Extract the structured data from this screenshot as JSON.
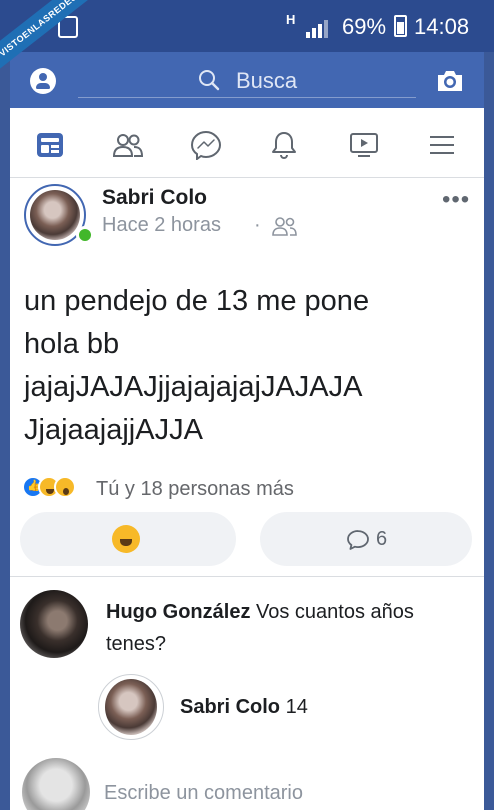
{
  "watermark": "VISTOENLASREDES",
  "status_bar": {
    "network": "H",
    "battery": "69%",
    "time": "14:08"
  },
  "search": {
    "placeholder": "Busca"
  },
  "nav_tabs": [
    "news-feed",
    "friends",
    "messenger",
    "notifications",
    "watch",
    "menu"
  ],
  "post": {
    "author": "Sabri Colo",
    "time": "Hace 2 horas",
    "separator": "·",
    "text_lines": [
      "un pendejo de 13 me pone",
      "hola bb",
      "jajajJAJAJjjajajajajJAJAJA",
      "JjajaajajjAJJA"
    ],
    "reaction_summary": "Tú y 18 personas más",
    "reaction_types": [
      "like",
      "haha",
      "wow"
    ],
    "comment_count": "6"
  },
  "comments": [
    {
      "author": "Hugo González",
      "text": "Vos cuantos años tenes?"
    }
  ],
  "reply": {
    "author": "Sabri Colo",
    "text": "14"
  },
  "composer": {
    "placeholder": "Escribe un comentario"
  },
  "colors": {
    "fb_blue": "#4267b2",
    "statusbar": "#2c4b8f",
    "online": "#42b72a"
  }
}
